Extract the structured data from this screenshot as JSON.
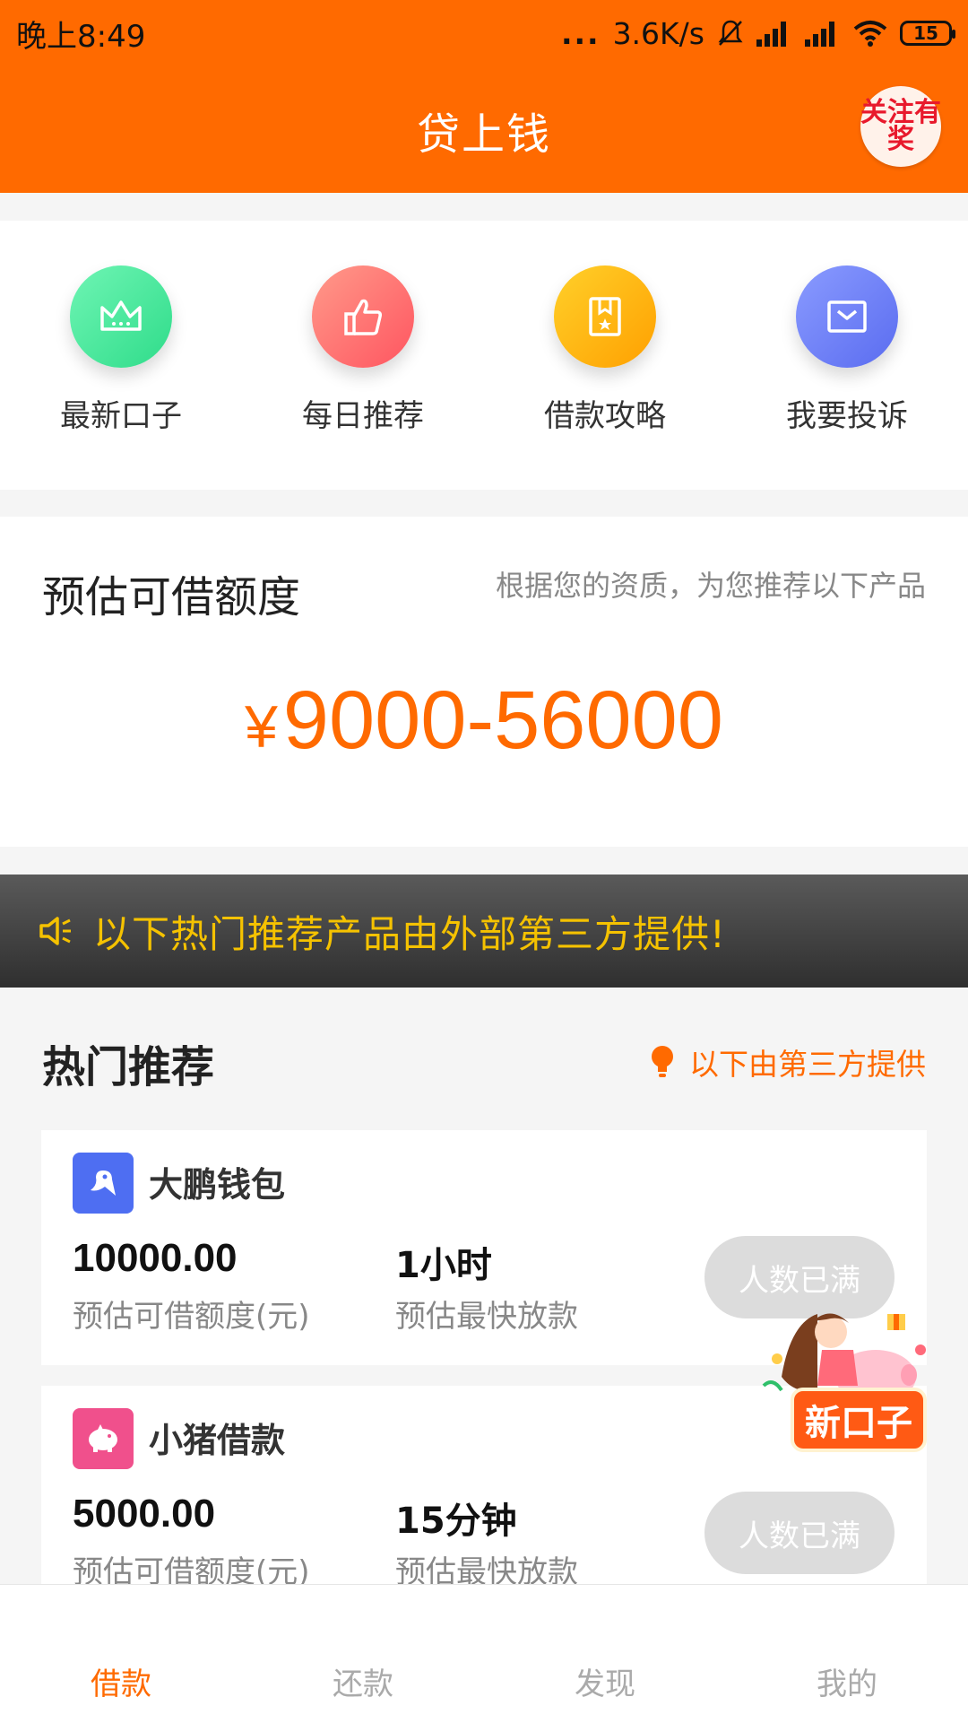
{
  "status_bar": {
    "time": "晚上8:49",
    "more_dots": "...",
    "network_speed": "3.6K/s",
    "battery": "15"
  },
  "app_bar": {
    "title": "贷上钱",
    "follow_badge": "关注有奖"
  },
  "quick_actions": [
    {
      "label": "最新口子",
      "icon": "crown-icon",
      "color": "#3ee59a"
    },
    {
      "label": "每日推荐",
      "icon": "thumbs-up-icon",
      "color": "#ff6b6b"
    },
    {
      "label": "借款攻略",
      "icon": "book-icon",
      "color": "#ffb400"
    },
    {
      "label": "我要投诉",
      "icon": "mail-icon",
      "color": "#6b7cf5"
    }
  ],
  "estimate": {
    "title": "预估可借额度",
    "note": "根据您的资质，为您推荐以下产品",
    "currency": "¥",
    "range": "9000-56000"
  },
  "notice": {
    "icon": "speaker-icon",
    "text": "以下热门推荐产品由外部第三方提供!"
  },
  "hot": {
    "title": "热门推荐",
    "note": "以下由第三方提供",
    "note_icon": "lightbulb-icon"
  },
  "products": [
    {
      "name": "大鹏钱包",
      "logo_color": "#4e6ef2",
      "amount": "10000.00",
      "amount_label": "预估可借额度(元)",
      "time": "1小时",
      "time_label": "预估最快放款",
      "button": "人数已满"
    },
    {
      "name": "小猪借款",
      "logo_color": "#f0508c",
      "amount": "5000.00",
      "amount_label": "预估可借额度(元)",
      "time": "15分钟",
      "time_label": "预估最快放款",
      "button": "人数已满"
    }
  ],
  "float_ad": {
    "label": "新口子"
  },
  "bottom_nav": [
    {
      "label": "借款",
      "active": true
    },
    {
      "label": "还款",
      "active": false
    },
    {
      "label": "发现",
      "active": false
    },
    {
      "label": "我的",
      "active": false
    }
  ],
  "colors": {
    "brand": "#ff6a00",
    "notice_text": "#f5c200",
    "disabled_button": "#dcdcdc"
  }
}
